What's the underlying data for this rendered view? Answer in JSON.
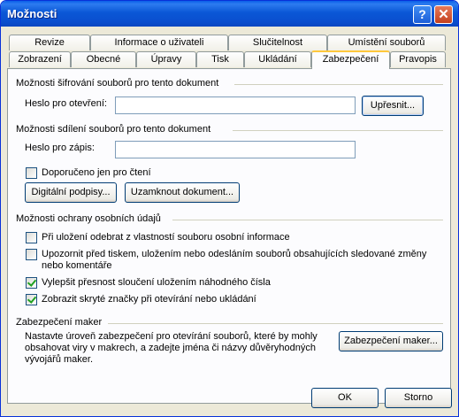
{
  "window": {
    "title": "Možnosti",
    "help_glyph": "?",
    "close_glyph": "✕"
  },
  "tabs": {
    "row1": [
      "Revize",
      "Informace o uživateli",
      "Slučitelnost",
      "Umístění souborů"
    ],
    "row2": [
      "Zobrazení",
      "Obecné",
      "Úpravy",
      "Tisk",
      "Ukládání",
      "Zabezpečení",
      "Pravopis"
    ],
    "active": "Zabezpečení"
  },
  "encryption": {
    "section": "Možnosti šifrování souborů pro tento dokument",
    "open_password_label": "Heslo pro otevření:",
    "open_password_value": "",
    "advanced_button": "Upřesnit..."
  },
  "sharing": {
    "section": "Možnosti sdílení souborů pro tento dokument",
    "modify_password_label": "Heslo pro zápis:",
    "modify_password_value": "",
    "readonly_label": "Doporučeno jen pro čtení",
    "readonly_checked": false,
    "signatures_button": "Digitální podpisy...",
    "protect_button": "Uzamknout dokument..."
  },
  "privacy": {
    "section": "Možnosti ochrany osobních údajů",
    "items": [
      {
        "label": "Při uložení odebrat z vlastností souboru osobní informace",
        "checked": false
      },
      {
        "label": "Upozornit před tiskem, uložením nebo odesláním souborů obsahujících sledované změny nebo komentáře",
        "checked": false
      },
      {
        "label": "Vylepšit přesnost sloučení uložením náhodného čísla",
        "checked": true
      },
      {
        "label": "Zobrazit skryté značky při otevírání nebo ukládání",
        "checked": true
      }
    ]
  },
  "macro": {
    "section": "Zabezpečení maker",
    "description": "Nastavte úroveň zabezpečení pro otevírání souborů, které by mohly obsahovat viry v makrech, a zadejte jména či názvy důvěryhodných vývojářů maker.",
    "button": "Zabezpečení maker..."
  },
  "footer": {
    "ok": "OK",
    "cancel": "Storno"
  }
}
